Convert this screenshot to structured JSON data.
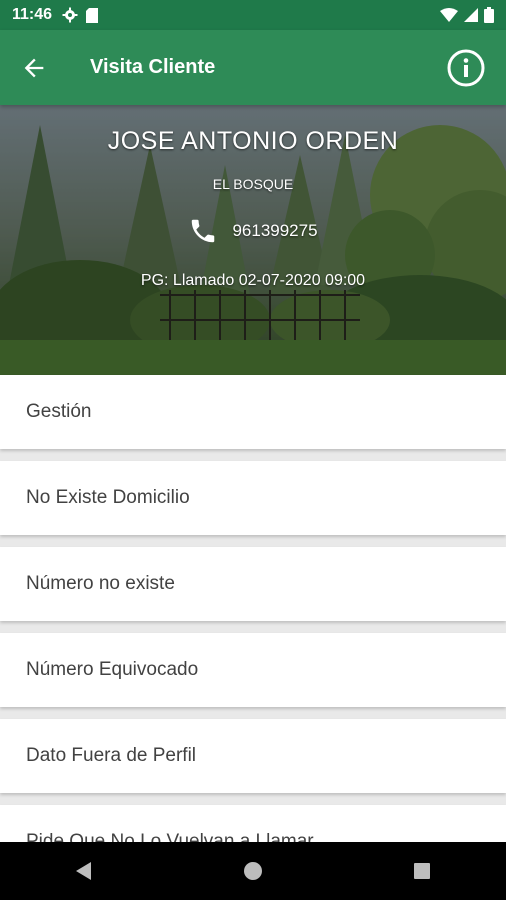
{
  "status_bar": {
    "time": "11:46",
    "icons": [
      "gear-icon",
      "sd-card-icon",
      "wifi-icon",
      "signal-icon",
      "battery-icon"
    ]
  },
  "app_bar": {
    "title": "Visita Cliente",
    "back_icon": "arrow-back-icon",
    "info_icon": "info-icon",
    "color": "#2e8b57"
  },
  "client": {
    "name": "JOSE ANTONIO ORDEN",
    "district": "EL BOSQUE",
    "phone": "961399275",
    "pg": "PG: Llamado 02-07-2020 09:00"
  },
  "options": [
    {
      "label": "Gestión"
    },
    {
      "label": "No Existe Domicilio"
    },
    {
      "label": "Número no existe"
    },
    {
      "label": "Número Equivocado"
    },
    {
      "label": "Dato Fuera de Perfil"
    },
    {
      "label": "Pide Que No Lo Vuelvan a Llamar"
    }
  ],
  "nav_bar": {
    "icons": [
      "nav-back-icon",
      "nav-home-icon",
      "nav-recents-icon"
    ]
  }
}
